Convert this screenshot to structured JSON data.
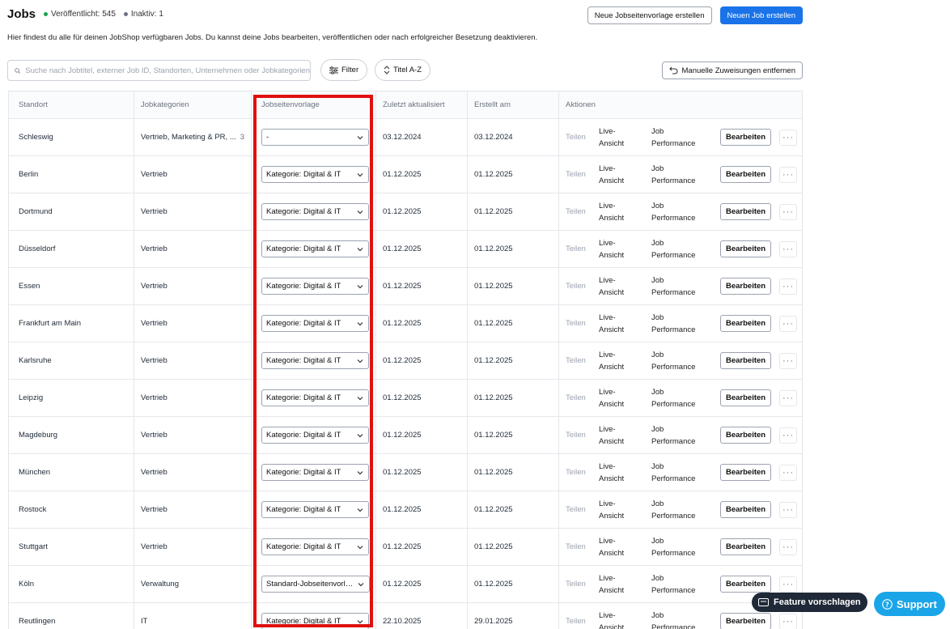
{
  "header": {
    "title": "Jobs",
    "published": "Veröffentlicht: 545",
    "inactive": "Inaktiv: 1",
    "new_template_label": "Neue Jobseitenvorlage erstellen",
    "new_job_label": "Neuen Job erstellen",
    "description": "Hier findest du alle für deinen JobShop verfügbaren Jobs. Du kannst deine Jobs bearbeiten, veröffentlichen oder nach erfolgreicher Besetzung deaktivieren."
  },
  "toolbar": {
    "search_placeholder": "Suche nach Jobtitel, externer Job ID, Standorten, Unternehmen oder Jobkategorien",
    "filter_label": "Filter",
    "sort_label": "Titel A-Z",
    "remove_assign_label": "Manuelle Zuweisungen entfernen"
  },
  "table": {
    "headers": {
      "location": "Standort",
      "categories": "Jobkategorien",
      "template": "Jobseitenvorlage",
      "updated": "Zuletzt aktualisiert",
      "created": "Erstellt am",
      "actions": "Aktionen"
    },
    "actions": {
      "share": "Teilen",
      "live": "Live-Ansicht",
      "performance": "Job Performance",
      "edit": "Bearbeiten",
      "more": "···"
    },
    "rows": [
      {
        "location": "Schleswig",
        "category": "Vertrieb, Marketing & PR, ...",
        "count": "3",
        "template": "-",
        "updated": "03.12.2024",
        "created": "03.12.2024"
      },
      {
        "location": "Berlin",
        "category": "Vertrieb",
        "count": "",
        "template": "Kategorie: Digital & IT",
        "updated": "01.12.2025",
        "created": "01.12.2025"
      },
      {
        "location": "Dortmund",
        "category": "Vertrieb",
        "count": "",
        "template": "Kategorie: Digital & IT",
        "updated": "01.12.2025",
        "created": "01.12.2025"
      },
      {
        "location": "Düsseldorf",
        "category": "Vertrieb",
        "count": "",
        "template": "Kategorie: Digital & IT",
        "updated": "01.12.2025",
        "created": "01.12.2025"
      },
      {
        "location": "Essen",
        "category": "Vertrieb",
        "count": "",
        "template": "Kategorie: Digital & IT",
        "updated": "01.12.2025",
        "created": "01.12.2025"
      },
      {
        "location": "Frankfurt am Main",
        "category": "Vertrieb",
        "count": "",
        "template": "Kategorie: Digital & IT",
        "updated": "01.12.2025",
        "created": "01.12.2025"
      },
      {
        "location": "Karlsruhe",
        "category": "Vertrieb",
        "count": "",
        "template": "Kategorie: Digital & IT",
        "updated": "01.12.2025",
        "created": "01.12.2025"
      },
      {
        "location": "Leipzig",
        "category": "Vertrieb",
        "count": "",
        "template": "Kategorie: Digital & IT",
        "updated": "01.12.2025",
        "created": "01.12.2025"
      },
      {
        "location": "Magdeburg",
        "category": "Vertrieb",
        "count": "",
        "template": "Kategorie: Digital & IT",
        "updated": "01.12.2025",
        "created": "01.12.2025"
      },
      {
        "location": "München",
        "category": "Vertrieb",
        "count": "",
        "template": "Kategorie: Digital & IT",
        "updated": "01.12.2025",
        "created": "01.12.2025"
      },
      {
        "location": "Rostock",
        "category": "Vertrieb",
        "count": "",
        "template": "Kategorie: Digital & IT",
        "updated": "01.12.2025",
        "created": "01.12.2025"
      },
      {
        "location": "Stuttgart",
        "category": "Vertrieb",
        "count": "",
        "template": "Kategorie: Digital & IT",
        "updated": "01.12.2025",
        "created": "01.12.2025"
      },
      {
        "location": "Köln",
        "category": "Verwaltung",
        "count": "",
        "template": "Standard-Jobseitenvorlage",
        "updated": "01.12.2025",
        "created": "01.12.2025"
      },
      {
        "location": "Reutlingen",
        "category": "IT",
        "count": "",
        "template": "Kategorie: Digital & IT",
        "updated": "22.10.2025",
        "created": "29.01.2025"
      }
    ]
  },
  "widgets": {
    "feature_label": "Feature vorschlagen",
    "support_label": "Support"
  },
  "colors": {
    "primary": "#1a73e8",
    "highlight": "#e01010",
    "support": "#1aa5e8",
    "published_dot": "#16a34a"
  }
}
